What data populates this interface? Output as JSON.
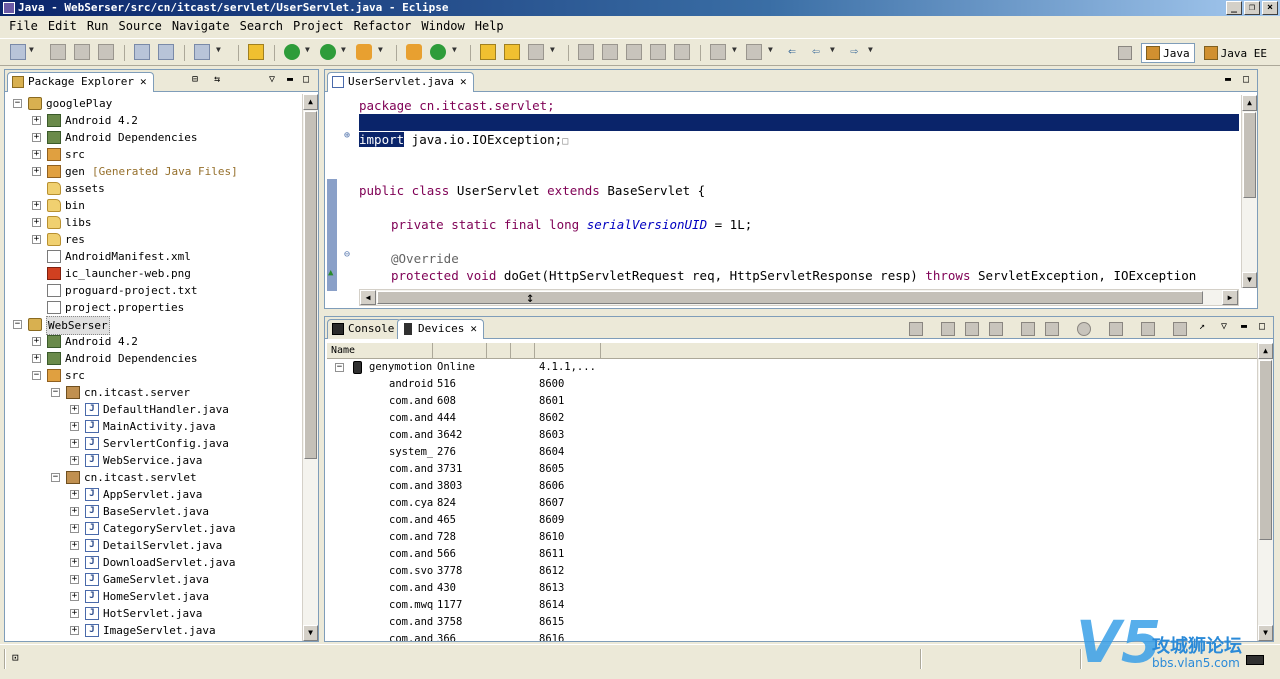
{
  "window": {
    "title": "Java - WebSerser/src/cn/itcast/servlet/UserServlet.java - Eclipse"
  },
  "menu": [
    "File",
    "Edit",
    "Run",
    "Source",
    "Navigate",
    "Search",
    "Project",
    "Refactor",
    "Window",
    "Help"
  ],
  "perspectives": {
    "java": "Java",
    "javaee": "Java EE"
  },
  "package_explorer": {
    "title": "Package Explorer",
    "nodes": [
      {
        "depth": 0,
        "expander": "−",
        "icon": "project",
        "label": "googlePlay"
      },
      {
        "depth": 1,
        "expander": "+",
        "icon": "lib",
        "label": "Android 4.2"
      },
      {
        "depth": 1,
        "expander": "+",
        "icon": "lib",
        "label": "Android Dependencies"
      },
      {
        "depth": 1,
        "expander": "+",
        "icon": "pkgsrc",
        "label": "src"
      },
      {
        "depth": 1,
        "expander": "+",
        "icon": "pkgsrc",
        "label": "gen",
        "extra": "[Generated Java Files]"
      },
      {
        "depth": 1,
        "expander": "",
        "icon": "folder",
        "label": "assets"
      },
      {
        "depth": 1,
        "expander": "+",
        "icon": "folder",
        "label": "bin"
      },
      {
        "depth": 1,
        "expander": "+",
        "icon": "folder",
        "label": "libs"
      },
      {
        "depth": 1,
        "expander": "+",
        "icon": "folder",
        "label": "res"
      },
      {
        "depth": 1,
        "expander": "",
        "icon": "file",
        "label": "AndroidManifest.xml"
      },
      {
        "depth": 1,
        "expander": "",
        "icon": "png",
        "label": "ic_launcher-web.png"
      },
      {
        "depth": 1,
        "expander": "",
        "icon": "file",
        "label": "proguard-project.txt"
      },
      {
        "depth": 1,
        "expander": "",
        "icon": "file",
        "label": "project.properties"
      },
      {
        "depth": 0,
        "expander": "−",
        "icon": "project",
        "label": "WebSerser",
        "selected": true
      },
      {
        "depth": 1,
        "expander": "+",
        "icon": "lib",
        "label": "Android 4.2"
      },
      {
        "depth": 1,
        "expander": "+",
        "icon": "lib",
        "label": "Android Dependencies"
      },
      {
        "depth": 1,
        "expander": "−",
        "icon": "pkgsrc",
        "label": "src"
      },
      {
        "depth": 2,
        "expander": "−",
        "icon": "package",
        "label": "cn.itcast.server"
      },
      {
        "depth": 3,
        "expander": "+",
        "icon": "java",
        "label": "DefaultHandler.java"
      },
      {
        "depth": 3,
        "expander": "+",
        "icon": "java",
        "label": "MainActivity.java"
      },
      {
        "depth": 3,
        "expander": "+",
        "icon": "java",
        "label": "ServlertConfig.java"
      },
      {
        "depth": 3,
        "expander": "+",
        "icon": "java",
        "label": "WebService.java"
      },
      {
        "depth": 2,
        "expander": "−",
        "icon": "package",
        "label": "cn.itcast.servlet"
      },
      {
        "depth": 3,
        "expander": "+",
        "icon": "java",
        "label": "AppServlet.java"
      },
      {
        "depth": 3,
        "expander": "+",
        "icon": "java",
        "label": "BaseServlet.java"
      },
      {
        "depth": 3,
        "expander": "+",
        "icon": "java",
        "label": "CategoryServlet.java"
      },
      {
        "depth": 3,
        "expander": "+",
        "icon": "java",
        "label": "DetailServlet.java"
      },
      {
        "depth": 3,
        "expander": "+",
        "icon": "java",
        "label": "DownloadServlet.java"
      },
      {
        "depth": 3,
        "expander": "+",
        "icon": "java",
        "label": "GameServlet.java"
      },
      {
        "depth": 3,
        "expander": "+",
        "icon": "java",
        "label": "HomeServlet.java"
      },
      {
        "depth": 3,
        "expander": "+",
        "icon": "java",
        "label": "HotServlet.java"
      },
      {
        "depth": 3,
        "expander": "+",
        "icon": "java",
        "label": "ImageServlet.java"
      }
    ]
  },
  "editor": {
    "tab": "UserServlet.java",
    "lines": {
      "l1": "package cn.itcast.servlet;",
      "import_kw": "import",
      "import_rest": " java.io.IOException;",
      "import_fold": "□",
      "class_kw": "public class",
      "class_name": " UserServlet ",
      "extends_kw": "extends",
      "class_rest": " BaseServlet {",
      "field_kw": "private static final long",
      "field_name": "serialVersionUID",
      "field_rest": " = 1L;",
      "annotation": "@Override",
      "method_kw": "protected void",
      "method_rest": " doGet(HttpServletRequest req, HttpServletResponse resp) ",
      "throws_kw": "throws",
      "throws_rest": " ServletException, IOException"
    }
  },
  "console": {
    "tab": "Console"
  },
  "devices": {
    "tab": "Devices",
    "header": {
      "name": "Name"
    },
    "rows": [
      {
        "name": "genymotion-",
        "col2": "Online",
        "col3": "4.1.1,...",
        "root": true
      },
      {
        "name": "android.",
        "col2": "516",
        "col3": "8600"
      },
      {
        "name": "com.andr",
        "col2": "608",
        "col3": "8601"
      },
      {
        "name": "com.andr",
        "col2": "444",
        "col3": "8602"
      },
      {
        "name": "com.andr",
        "col2": "3642",
        "col3": "8603"
      },
      {
        "name": "system_p",
        "col2": "276",
        "col3": "8604"
      },
      {
        "name": "com.andr",
        "col2": "3731",
        "col3": "8605"
      },
      {
        "name": "com.andr",
        "col2": "3803",
        "col3": "8606"
      },
      {
        "name": "com.cyan",
        "col2": "824",
        "col3": "8607"
      },
      {
        "name": "com.andr",
        "col2": "465",
        "col3": "8609"
      },
      {
        "name": "com.andr",
        "col2": "728",
        "col3": "8610"
      },
      {
        "name": "com.andr",
        "col2": "566",
        "col3": "8611"
      },
      {
        "name": "com.svox",
        "col2": "3778",
        "col3": "8612"
      },
      {
        "name": "com.andr",
        "col2": "430",
        "col3": "8613"
      },
      {
        "name": "com.mwqi",
        "col2": "1177",
        "col3": "8614"
      },
      {
        "name": "com.andr",
        "col2": "3758",
        "col3": "8615"
      },
      {
        "name": "com.andr",
        "col2": "366",
        "col3": "8616"
      }
    ]
  },
  "watermark": {
    "line1": "攻城狮论坛",
    "line2": "bbs.vlan5.com"
  },
  "colors": {
    "keyword": "#7f0055",
    "selection": "#0a246a",
    "field": "#0000c0"
  }
}
